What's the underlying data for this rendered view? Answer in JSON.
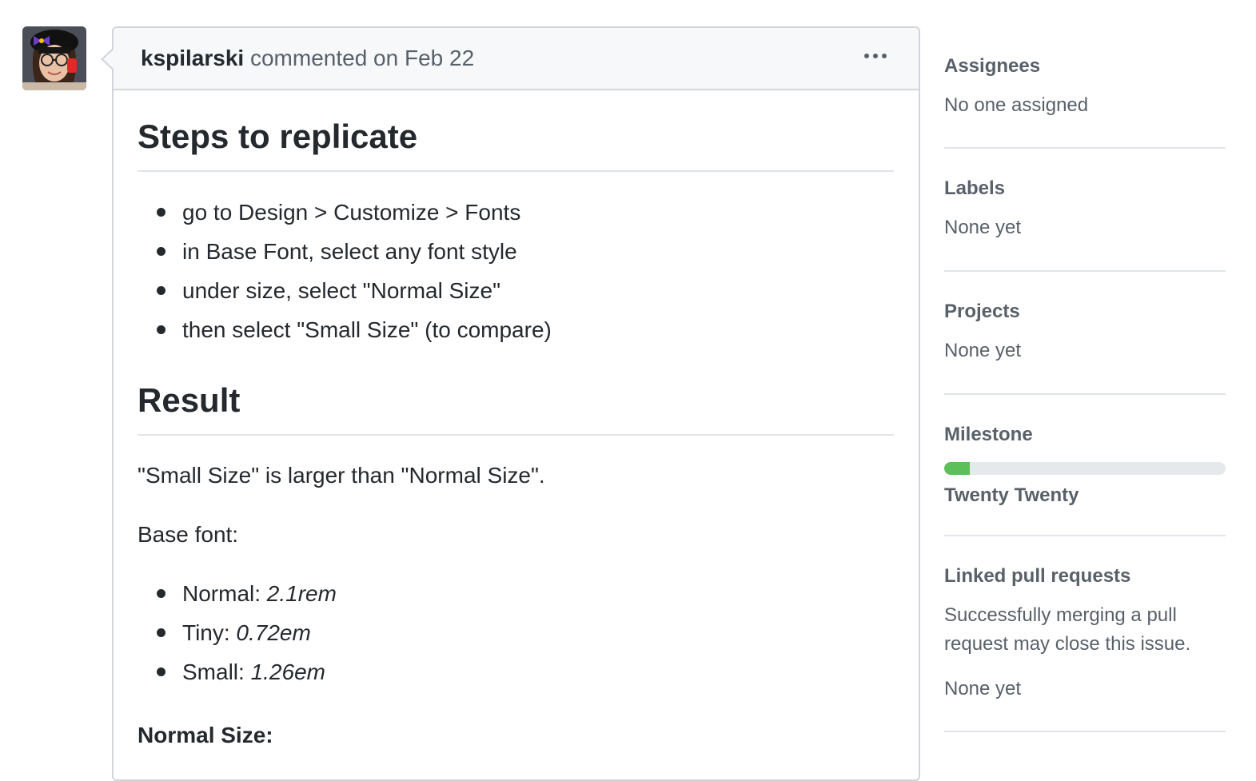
{
  "comment": {
    "author": "kspilarski",
    "action": "commented on Feb 22",
    "body": {
      "heading1": "Steps to replicate",
      "steps": [
        "go to Design > Customize > Fonts",
        "in Base Font, select any font style",
        "under size, select \"Normal Size\"",
        "then select \"Small Size\" (to compare)"
      ],
      "heading2": "Result",
      "result_text": "\"Small Size\" is larger than \"Normal Size\".",
      "base_font_label": "Base font:",
      "font_sizes": [
        {
          "label": "Normal: ",
          "value": "2.1rem"
        },
        {
          "label": "Tiny: ",
          "value": "0.72em"
        },
        {
          "label": "Small: ",
          "value": "1.26em"
        }
      ],
      "normal_size_label": "Normal Size:"
    }
  },
  "sidebar": {
    "assignees": {
      "heading": "Assignees",
      "value": "No one assigned"
    },
    "labels": {
      "heading": "Labels",
      "value": "None yet"
    },
    "projects": {
      "heading": "Projects",
      "value": "None yet"
    },
    "milestone": {
      "heading": "Milestone",
      "progress_percent": 9,
      "name": "Twenty Twenty"
    },
    "linked_prs": {
      "heading": "Linked pull requests",
      "description_line1": "Successfully merging a pull",
      "description_line2": "request may close this issue.",
      "value": "None yet"
    }
  },
  "colors": {
    "progress_fill": "#5cbf5a",
    "muted_text": "#586069",
    "border": "#d1d5da"
  }
}
